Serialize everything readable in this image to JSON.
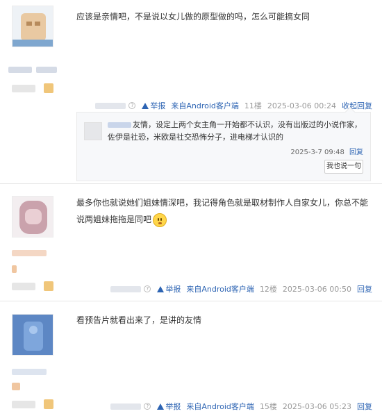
{
  "posts": [
    {
      "text": "应该是亲情吧，不是说以女儿做的原型做的吗，怎么可能搞女同",
      "meta": {
        "report": "举报",
        "source": "来自Android客户端",
        "floor": "11楼",
        "time": "2025-03-06 00:24",
        "action": "收起回复"
      },
      "reply": {
        "text": "友情，设定上两个女主角一开始都不认识，没有出版过的小说作家，佐伊是社恐，米欧是社交恐怖分子，进电梯才认识的",
        "time": "2025-3-7 09:48",
        "reply_label": "回复",
        "button": "我也说一句"
      }
    },
    {
      "text": "最多你也就说她们姐妹情深吧，我记得角色就是取材制作人自家女儿，你总不能说两姐妹拖拖是同吧",
      "emoji": "smile-emoji",
      "meta": {
        "report": "举报",
        "source": "来自Android客户端",
        "floor": "12楼",
        "time": "2025-03-06 00:50",
        "action": "回复"
      }
    },
    {
      "text": "看预告片就看出来了，是讲的友情",
      "meta": {
        "report": "举报",
        "source": "来自Android客户端",
        "floor": "15楼",
        "time": "2025-03-06 05:23",
        "action": "回复"
      }
    }
  ],
  "colors": {
    "link": "#2d64b3",
    "meta": "#999999",
    "divider": "#e6e6e6"
  },
  "icons": {
    "report": "warning-icon",
    "help": "question-icon"
  }
}
